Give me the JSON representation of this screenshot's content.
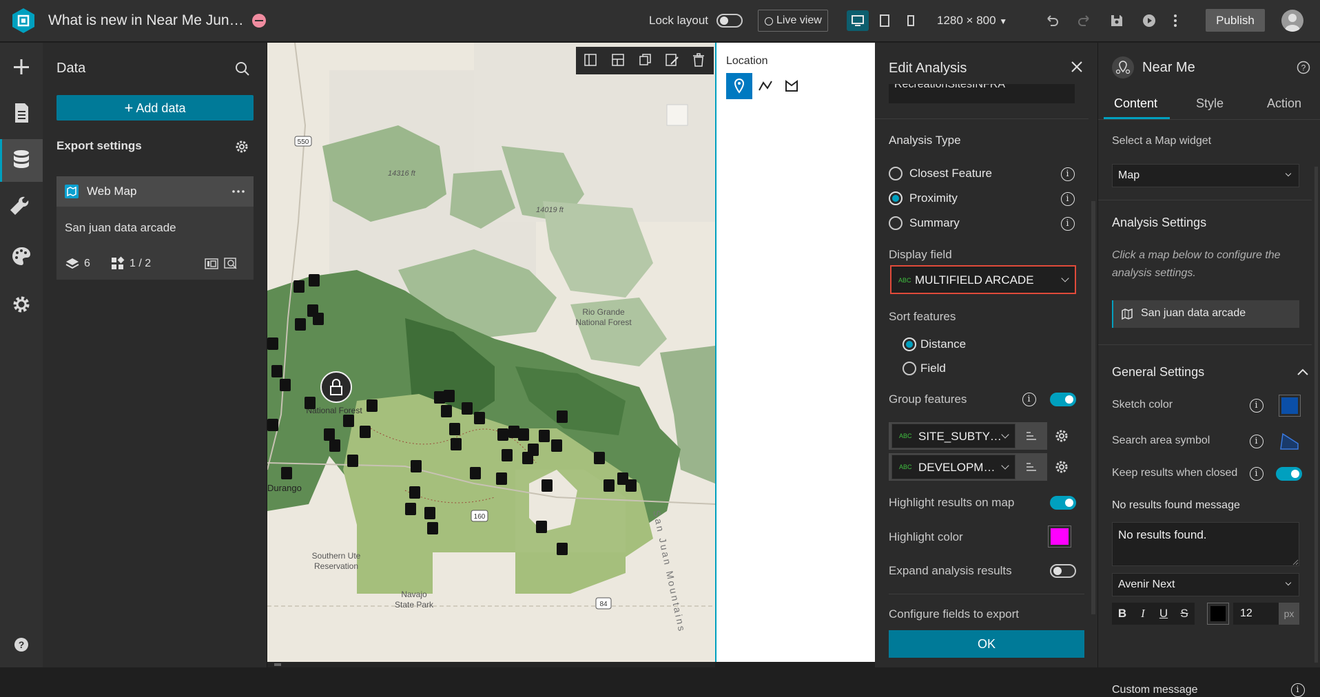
{
  "app": {
    "title": "What is new in Near Me Jun…",
    "lock_layout_label": "Lock layout",
    "live_view_label": "Live view",
    "resolution": "1280 × 800",
    "publish_label": "Publish",
    "accent_color": "#00a0bf"
  },
  "data_panel": {
    "title": "Data",
    "add_data_label": "Add data",
    "export_settings_label": "Export settings",
    "datasource": {
      "type_label": "Web Map",
      "name": "San juan data arcade",
      "layers_count": "6",
      "tables_count": "1 / 2"
    }
  },
  "map": {
    "labels": {
      "highway_550": "550",
      "peak1": "14316 ft",
      "peak2": "14019 ft",
      "rio_grande": "Rio Grande",
      "national_forest": "National Forest",
      "san_juan_nf": "National\nForest",
      "durango": "Durango",
      "highway_160": "160",
      "highway_84": "84",
      "southern_ute": "Southern Ute",
      "reservation": "Reservation",
      "navajo": "Navajo",
      "state_park": "State Park",
      "san_juan_mountains": "San Juan Mountains"
    }
  },
  "location_widget": {
    "label": "Location"
  },
  "edit_analysis": {
    "title": "Edit Analysis",
    "layer_name": "RecreationSitesINFRA",
    "analysis_type_label": "Analysis Type",
    "analysis_types": [
      {
        "label": "Closest Feature",
        "selected": false
      },
      {
        "label": "Proximity",
        "selected": true
      },
      {
        "label": "Summary",
        "selected": false
      }
    ],
    "display_field_label": "Display field",
    "display_field_value": "MULTIFIELD ARCADE",
    "sort_features_label": "Sort features",
    "sort_options": [
      {
        "label": "Distance",
        "selected": true
      },
      {
        "label": "Field",
        "selected": false
      }
    ],
    "group_features_label": "Group features",
    "group_fields": [
      "SITE_SUBTY…",
      "DEVELOPM…"
    ],
    "highlight_results_label": "Highlight results on map",
    "highlight_color_label": "Highlight color",
    "highlight_color": "#ff00ff",
    "expand_results_label": "Expand analysis results",
    "configure_fields_label": "Configure fields to export",
    "ok_label": "OK"
  },
  "near_me": {
    "title": "Near Me",
    "tabs": [
      "Content",
      "Style",
      "Action"
    ],
    "active_tab": "Content",
    "select_map_label": "Select a Map widget",
    "map_value": "Map",
    "analysis_settings_label": "Analysis Settings",
    "analysis_hint": "Click a map below to configure the analysis settings.",
    "map_source": "San juan data arcade",
    "general_settings_label": "General Settings",
    "sketch_color_label": "Sketch color",
    "sketch_color": "#0b4fa8",
    "search_area_symbol_label": "Search area symbol",
    "keep_results_label": "Keep results when closed",
    "no_results_label": "No results found message",
    "no_results_text": "No results found.",
    "font_value": "Avenir Next",
    "font_size": "12",
    "font_unit": "px",
    "text_color": "#000000",
    "custom_message_label": "Custom message"
  }
}
